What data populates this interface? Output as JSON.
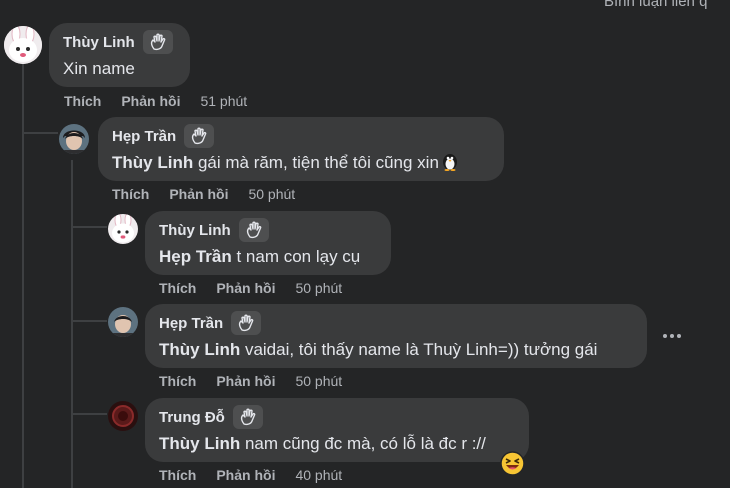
{
  "top_note": "Bình luận liên q",
  "icons": {
    "wave": "waving-hand-icon",
    "penguin": "penguin-emoji",
    "laugh": "grinning-squinting-face-emoji",
    "more": "more-options-icon"
  },
  "actions": {
    "like": "Thích",
    "reply": "Phản hồi"
  },
  "comments": [
    {
      "author": "Thùy Linh",
      "mention": "",
      "text": "Xin name",
      "time": "51 phút"
    },
    {
      "author": "Hẹp Trần",
      "mention": "Thùy Linh",
      "text": " gái mà răm, tiện thể tôi cũng xin",
      "time": "50 phút"
    },
    {
      "author": "Thùy Linh",
      "mention": "Hẹp Trần",
      "text": " t nam con lạy cụ",
      "time": "50 phút"
    },
    {
      "author": "Hẹp Trần",
      "mention": "Thùy Linh",
      "text": " vaidai, tôi thấy name là Thuỳ Linh=)) tưởng gái",
      "time": "50 phút"
    },
    {
      "author": "Trung Đỗ",
      "mention": "Thùy Linh",
      "text": " nam cũng đc mà, có lỗ là đc r ://",
      "time": "40 phút"
    }
  ],
  "colors": {
    "background": "#242526",
    "bubble": "#3a3b3c",
    "text": "#e4e6eb",
    "muted": "#b0b3b8"
  }
}
